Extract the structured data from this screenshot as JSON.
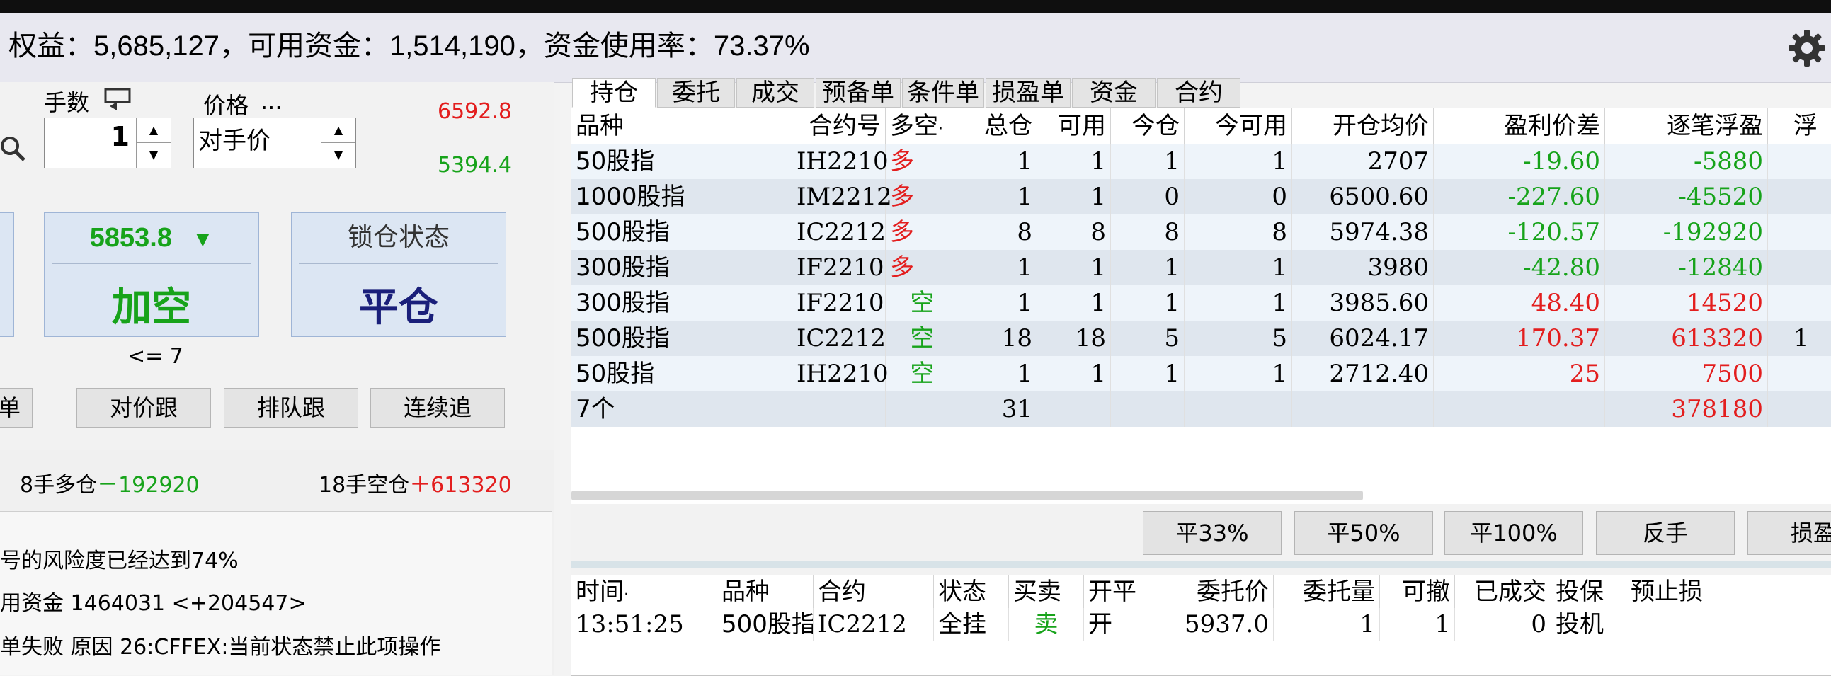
{
  "summary": "权益：5,685,127，可用资金：1,514,190，资金使用率：73.37%",
  "order_panel": {
    "qty_label": "手数",
    "qty_value": "1",
    "price_label": "价格",
    "price_more": "...",
    "price_mode": "对手价",
    "upper_price": "6592.8",
    "lower_price": "5394.4",
    "sell_price": "5853.8",
    "sell_arrow": "▼",
    "sell_action": "加空",
    "lock_label": "锁仓状态",
    "close_action": "平仓",
    "limit_text": "<= 7",
    "buttons": [
      "单",
      "对价跟",
      "排队跟",
      "连续追"
    ],
    "long_pos": "8手多仓",
    "long_pnl": "－192920",
    "short_pos": "18手空仓",
    "short_pnl": "＋613320"
  },
  "messages": [
    "号的风险度已经达到74%",
    "用资金 1464031  <+204547>",
    "单失败  原因  26:CFFEX:当前状态禁止此项操作"
  ],
  "tabs": [
    "持仓",
    "委托",
    "成交",
    "预备单",
    "条件单",
    "损盈单",
    "资金",
    "合约"
  ],
  "positions": {
    "headers": [
      "品种",
      "合约号",
      "多空",
      "总仓",
      "可用",
      "今仓",
      "今可用",
      "开仓均价",
      "盈利价差",
      "逐笔浮盈",
      "浮"
    ],
    "sort_mark": "·",
    "rows": [
      {
        "product": "50股指",
        "contract": "IH2210",
        "side": "多",
        "total": "1",
        "avail": "1",
        "today": "1",
        "today_avail": "1",
        "avg": "2707",
        "spread": "-19.60",
        "pnl": "-5880",
        "extra": ""
      },
      {
        "product": "1000股指",
        "contract": "IM2212",
        "side": "多",
        "total": "1",
        "avail": "1",
        "today": "0",
        "today_avail": "0",
        "avg": "6500.60",
        "spread": "-227.60",
        "pnl": "-45520",
        "extra": ""
      },
      {
        "product": "500股指",
        "contract": "IC2212",
        "side": "多",
        "total": "8",
        "avail": "8",
        "today": "8",
        "today_avail": "8",
        "avg": "5974.38",
        "spread": "-120.57",
        "pnl": "-192920",
        "extra": ""
      },
      {
        "product": "300股指",
        "contract": "IF2210",
        "side": "多",
        "total": "1",
        "avail": "1",
        "today": "1",
        "today_avail": "1",
        "avg": "3980",
        "spread": "-42.80",
        "pnl": "-12840",
        "extra": ""
      },
      {
        "product": "300股指",
        "contract": "IF2210",
        "side": "空",
        "total": "1",
        "avail": "1",
        "today": "1",
        "today_avail": "1",
        "avg": "3985.60",
        "spread": "48.40",
        "pnl": "14520",
        "extra": ""
      },
      {
        "product": "500股指",
        "contract": "IC2212",
        "side": "空",
        "total": "18",
        "avail": "18",
        "today": "5",
        "today_avail": "5",
        "avg": "6024.17",
        "spread": "170.37",
        "pnl": "613320",
        "extra": "1"
      },
      {
        "product": "50股指",
        "contract": "IH2210",
        "side": "空",
        "total": "1",
        "avail": "1",
        "today": "1",
        "today_avail": "1",
        "avg": "2712.40",
        "spread": "25",
        "pnl": "7500",
        "extra": ""
      }
    ],
    "total_row": {
      "label": "7个",
      "total": "31",
      "pnl": "378180"
    }
  },
  "actions": [
    "平33%",
    "平50%",
    "平100%",
    "反手",
    "损盈"
  ],
  "orders": {
    "headers": [
      "时间",
      "品种",
      "合约",
      "状态",
      "买卖",
      "开平",
      "委托价",
      "委托量",
      "可撤",
      "已成交",
      "投保",
      "预止损"
    ],
    "rows": [
      {
        "time": "13:51:25",
        "product": "500股指",
        "contract": "IC2212",
        "status": "全挂",
        "side": "卖",
        "oc": "开",
        "price": "5937.0",
        "qty": "1",
        "cancelable": "1",
        "filled": "0",
        "hedge": "投机",
        "stop": ""
      }
    ]
  }
}
